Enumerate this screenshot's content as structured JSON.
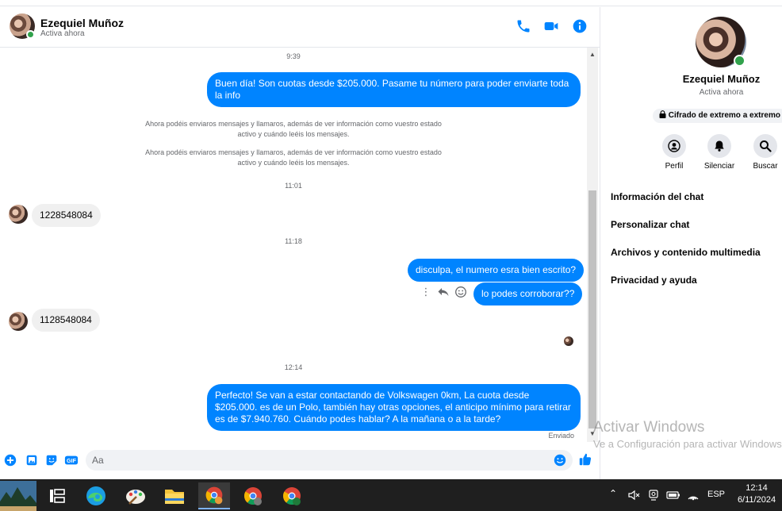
{
  "contact": {
    "name": "Ezequiel Muñoz",
    "status": "Activa ahora"
  },
  "messages": {
    "time_1": "9:39",
    "out_1": "Buen día! Son cuotas desde $205.000. Pasame tu número para poder enviarte toda la info",
    "sys_1": "Ahora podéis enviaros mensajes y llamaros, además de ver información como vuestro estado activo y cuándo leéis los mensajes.",
    "sys_2": "Ahora podéis enviaros mensajes y llamaros, además de ver información como vuestro estado activo y cuándo leéis los mensajes.",
    "time_2": "11:01",
    "in_1": "1228548084",
    "time_3": "11:18",
    "out_2": "disculpa, el numero esra bien escrito?",
    "out_3": "lo podes corroborar??",
    "in_2": "1128548084",
    "time_4": "12:14",
    "out_4": "Perfecto!  Se van a estar contactando de Volkswagen 0km, La cuota desde $205.000. es de un Polo, también hay otras opciones, el anticipo mínimo para retirar es de $7.940.760. Cuándo podes hablar? A la mañana o a la tarde?",
    "sent_label": "Enviado"
  },
  "composer": {
    "placeholder": "Aa"
  },
  "details": {
    "name": "Ezequiel Muñoz",
    "status": "Activa ahora",
    "encryption": "Cifrado de extremo a extremo",
    "actions": [
      "Perfil",
      "Silenciar",
      "Buscar"
    ],
    "menu": [
      "Información del chat",
      "Personalizar chat",
      "Archivos y contenido multimedia",
      "Privacidad y ayuda"
    ]
  },
  "watermark": {
    "title": "Activar Windows",
    "subtitle": "Ve a Configuración para activar Windows."
  },
  "taskbar": {
    "language": "ESP",
    "time": "12:14",
    "date": "6/11/2024"
  },
  "colors": {
    "accent": "#0084ff",
    "online": "#31a24c",
    "incoming_bubble": "#f0f0f0",
    "taskbar": "#1f1f1f"
  }
}
